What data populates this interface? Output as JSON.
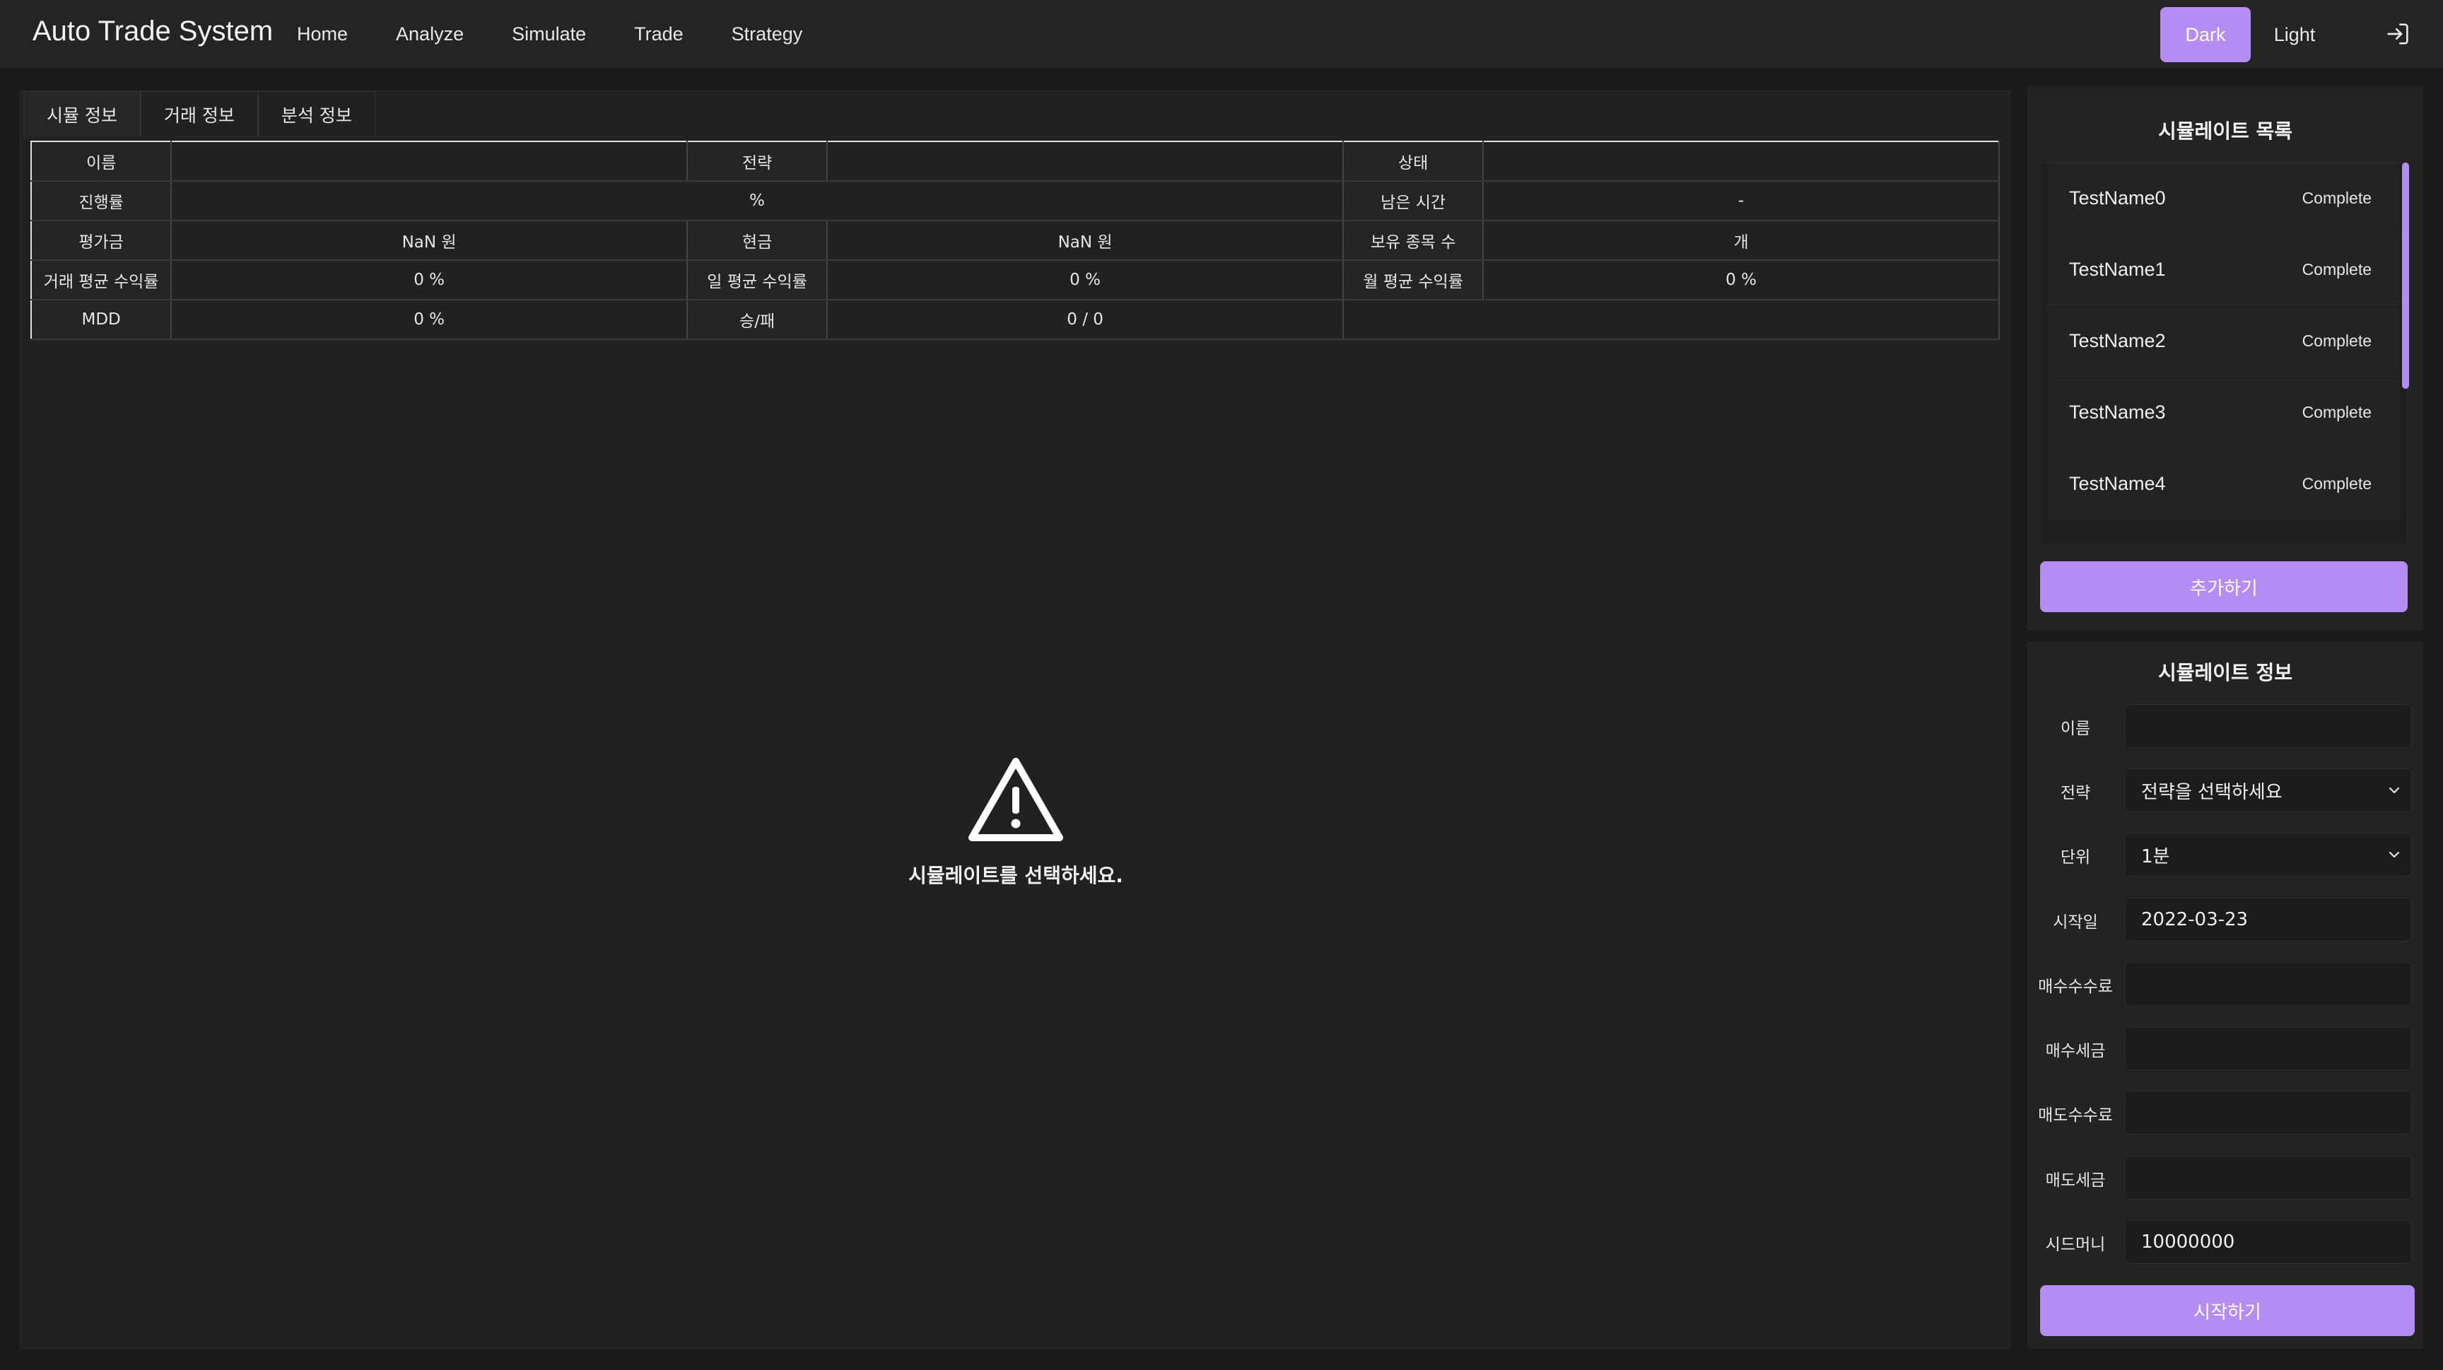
{
  "header": {
    "brand": "Auto Trade System",
    "nav": [
      "Home",
      "Analyze",
      "Simulate",
      "Trade",
      "Strategy"
    ],
    "theme_dark": "Dark",
    "theme_light": "Light",
    "logout_icon": "logout-icon"
  },
  "main": {
    "tabs": [
      "시뮬 정보",
      "거래 정보",
      "분석 정보"
    ],
    "table": {
      "r1": [
        "이름",
        "",
        "전략",
        "",
        "상태",
        ""
      ],
      "r2": [
        "진행률",
        "%",
        "남은 시간",
        "-"
      ],
      "r3": [
        "평가금",
        "NaN 원",
        "현금",
        "NaN 원",
        "보유 종목 수",
        "개"
      ],
      "r4": [
        "거래 평균 수익률",
        "0 %",
        "일 평균 수익률",
        "0 %",
        "월 평균 수익률",
        "0 %"
      ],
      "r5": [
        "MDD",
        "0 %",
        "승/패",
        "0 / 0",
        ""
      ]
    },
    "empty_icon": "warning-icon",
    "empty_message": "시뮬레이트를 선택하세요."
  },
  "sim_list": {
    "title": "시뮬레이트 목록",
    "items": [
      {
        "name": "TestName0",
        "status": "Complete"
      },
      {
        "name": "TestName1",
        "status": "Complete"
      },
      {
        "name": "TestName2",
        "status": "Complete"
      },
      {
        "name": "TestName3",
        "status": "Complete"
      },
      {
        "name": "TestName4",
        "status": "Complete"
      }
    ],
    "add_button": "추가하기"
  },
  "sim_info": {
    "title": "시뮬레이트 정보",
    "fields": {
      "name": {
        "label": "이름",
        "value": ""
      },
      "strategy": {
        "label": "전략",
        "value": "전략을 선택하세요"
      },
      "unit": {
        "label": "단위",
        "value": "1분"
      },
      "start_date": {
        "label": "시작일",
        "value": "2022-03-23"
      },
      "buy_fee": {
        "label": "매수수수료",
        "value": ""
      },
      "buy_tax": {
        "label": "매수세금",
        "value": ""
      },
      "sell_fee": {
        "label": "매도수수료",
        "value": ""
      },
      "sell_tax": {
        "label": "매도세금",
        "value": ""
      },
      "seed_money": {
        "label": "시드머니",
        "value": "10000000"
      }
    },
    "start_button": "시작하기"
  },
  "colors": {
    "accent": "#b48cf2",
    "background": "#1b1b1b",
    "panel": "#232323"
  }
}
